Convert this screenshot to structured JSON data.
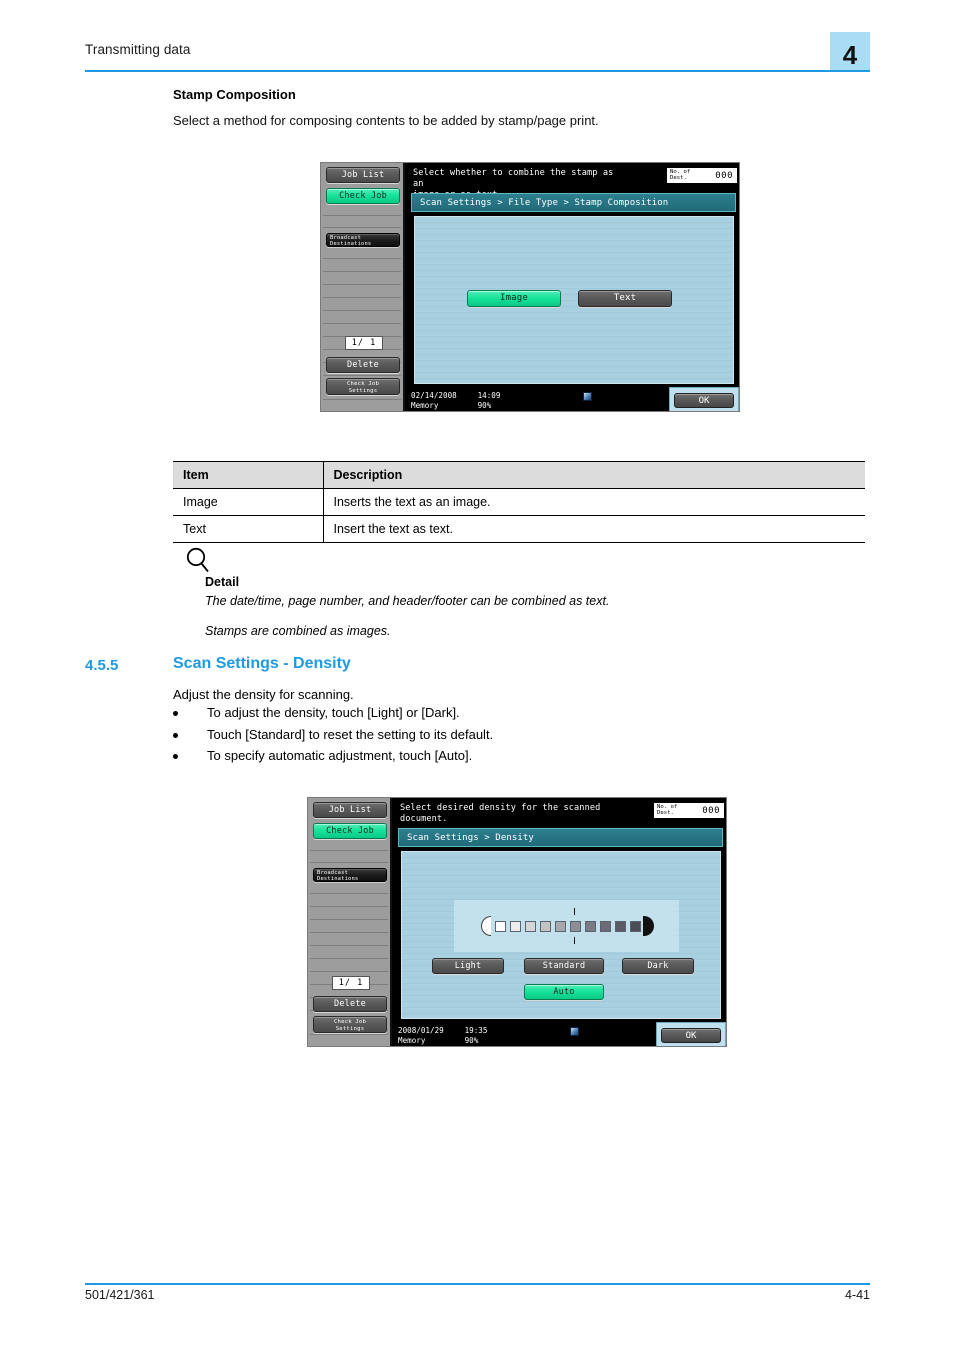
{
  "header": {
    "title": "Transmitting data",
    "chapter": "4",
    "chapter_bg": "#a9dcf5",
    "rule_color": "#1d9ae2"
  },
  "stamp_section": {
    "heading": "Stamp Composition",
    "intro": "Select a method for composing contents to be added by stamp/page print."
  },
  "screen_stamp": {
    "message_line1": "Select whether to combine the stamp as an",
    "message_line2": "image or as text.",
    "dest_label_line1": "No. of",
    "dest_label_line2": "Dest.",
    "dest_value": "000",
    "breadcrumb": "Scan Settings > File Type > Stamp Composition",
    "rail": {
      "job_list": "Job List",
      "check_job": "Check Job",
      "broadcast_line1": "Broadcast",
      "broadcast_line2": "Destinations",
      "page_counter": "1/  1",
      "delete": "Delete",
      "check_job_settings_line1": "Check Job",
      "check_job_settings_line2": "Settings"
    },
    "buttons": {
      "image": "Image",
      "text": "Text"
    },
    "status": {
      "date": "02/14/2008",
      "time": "14:09",
      "memory_label": "Memory",
      "memory_value": "90%"
    },
    "ok": "OK"
  },
  "table": {
    "headers": [
      "Item",
      "Description"
    ],
    "rows": [
      [
        "Image",
        "Inserts the text as an image."
      ],
      [
        "Text",
        "Insert the text as text."
      ]
    ]
  },
  "detail": {
    "icon": "magnifier-icon",
    "heading": "Detail",
    "line1": "The date/time, page number, and header/footer can be combined as text.",
    "line2": "Stamps are combined as images."
  },
  "density_section": {
    "number": "4.5.5",
    "title": "Scan Settings - Density",
    "accent_color": "#1d9ae2",
    "intro": "Adjust the density for scanning.",
    "bullets": [
      "To adjust the density, touch [Light] or [Dark].",
      "Touch [Standard] to reset the setting to its default.",
      "To specify automatic adjustment, touch [Auto]."
    ]
  },
  "screen_density": {
    "message_line1": "Select desired density for the scanned",
    "message_line2": "document.",
    "dest_label_line1": "No. of",
    "dest_label_line2": "Dest.",
    "dest_value": "000",
    "breadcrumb": "Scan Settings > Density",
    "rail": {
      "job_list": "Job List",
      "check_job": "Check Job",
      "broadcast_line1": "Broadcast",
      "broadcast_line2": "Destinations",
      "page_counter": "1/  1",
      "delete": "Delete",
      "check_job_settings_line1": "Check Job",
      "check_job_settings_line2": "Settings"
    },
    "buttons": {
      "light": "Light",
      "standard": "Standard",
      "dark": "Dark",
      "auto": "Auto"
    },
    "density_scale": {
      "steps": [
        "#ffffff",
        "#ececec",
        "#d6d6d6",
        "#c2c2c2",
        "#a7a7ad",
        "#8e8e96",
        "#7b7b84",
        "#6c6c76",
        "#5c5c66",
        "#4d4d57"
      ],
      "selected_index": 5
    },
    "status": {
      "date": "2008/01/29",
      "time": "19:35",
      "memory_label": "Memory",
      "memory_value": "90%"
    },
    "ok": "OK"
  },
  "footer": {
    "left": "501/421/361",
    "right": "4-41",
    "rule_color": "#1d9ae2"
  }
}
